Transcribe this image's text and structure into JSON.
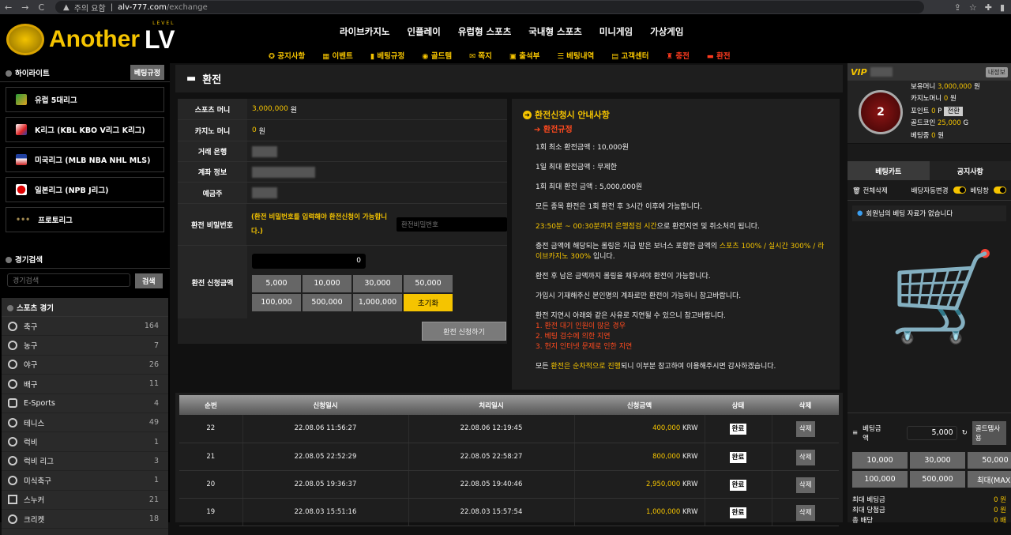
{
  "browser": {
    "warning": "주의 요함",
    "host": "alv-777.com",
    "path": "/exchange"
  },
  "logo": {
    "text": "Another",
    "lv": "LV",
    "level": "LEVEL"
  },
  "mainnav": [
    "라이브카지노",
    "인플레이",
    "유럽형 스포츠",
    "국내형 스포츠",
    "미니게임",
    "가상게임"
  ],
  "subnav": [
    {
      "icon": "gear-icon",
      "label": "공지사항"
    },
    {
      "icon": "gift-icon",
      "label": "이벤트"
    },
    {
      "icon": "book-icon",
      "label": "베팅규정"
    },
    {
      "icon": "coin-icon",
      "label": "골드템"
    },
    {
      "icon": "mail-icon",
      "label": "쪽지"
    },
    {
      "icon": "calendar-icon",
      "label": "출석부"
    },
    {
      "icon": "list-icon",
      "label": "베팅내역"
    },
    {
      "icon": "headset-icon",
      "label": "고객센터"
    },
    {
      "icon": "bank-icon",
      "label": "충전"
    },
    {
      "icon": "card-icon",
      "label": "환전"
    }
  ],
  "sidebar": {
    "highlight_title": "하이라이트",
    "rules_btn": "베팅규정",
    "leagues": [
      "유럽 5대리그",
      "K리그 (KBL KBO V리그 K리그)",
      "미국리그 (MLB NBA NHL MLS)",
      "일본리그 (NPB J리그)",
      "프로토리그"
    ],
    "search_title": "경기검색",
    "search_placeholder": "경기검색",
    "search_btn": "검색",
    "sports_title": "스포츠 경기",
    "sports": [
      {
        "name": "축구",
        "count": "164"
      },
      {
        "name": "농구",
        "count": "7"
      },
      {
        "name": "야구",
        "count": "26"
      },
      {
        "name": "배구",
        "count": "11"
      },
      {
        "name": "E-Sports",
        "count": "4"
      },
      {
        "name": "테니스",
        "count": "49"
      },
      {
        "name": "럭비",
        "count": "1"
      },
      {
        "name": "럭비 리그",
        "count": "3"
      },
      {
        "name": "미식축구",
        "count": "1"
      },
      {
        "name": "스누커",
        "count": "21"
      },
      {
        "name": "크리켓",
        "count": "18"
      }
    ]
  },
  "page": {
    "title": "환전"
  },
  "form": {
    "sports_money_label": "스포츠 머니",
    "sports_money": "3,000,000",
    "won": "원",
    "casino_money_label": "카지노 머니",
    "casino_money": "0",
    "bank_label": "거래 은행",
    "account_label": "계좌 정보",
    "holder_label": "예금주",
    "pw_label": "환전 비밀번호",
    "pw_notice": "(환전 비밀번호를 입력해야 환전신청이 가능합니다.)",
    "pw_placeholder": "환전비밀번호",
    "amount_label": "환전 신청금액",
    "amount_value": "0",
    "quick": [
      "5,000",
      "10,000",
      "30,000",
      "50,000",
      "100,000",
      "500,000",
      "1,000,000"
    ],
    "reset": "초기화",
    "apply": "환전 신청하기"
  },
  "notice": {
    "title": "환전신청시 안내사항",
    "rule_title": "환전규정",
    "min": "1회 최소 환전금액 : 10,000원",
    "daily": "1일 최대 환전금액 : 무제한",
    "max": "1회 최대 환전 금액 : 5,000,000원",
    "p1": "모든 종목 환전은 1회 환전 후 3시간 이후에 가능합니다.",
    "p2a": "23:50분 ~ 00:30분까지 은행점검 시간",
    "p2b": "으로 환전지연 및 취소처리 됩니다.",
    "p3a": "충전 금액에 해당되는 롤링은 지급 받은 보너스 포함한 금액의 ",
    "p3b": "스포츠 100% / 실시간 300% / 라이브카지노 300%",
    "p3c": " 입니다.",
    "p4": "환전 후 남은 금액까지 롤링을 채우셔야 환전이 가능합니다.",
    "p5": "가입시 기재해주신 본인명의 계좌로만 환전이 가능하니 참고바랍니다.",
    "p6": "환전 지연시 아래와 같은 사유로 지연될 수 있으니 참고바랍니다.",
    "r1": "1. 환전 대기 인원이 많은 경우",
    "r2": "2. 베팅 검수에 의한 지연",
    "r3": "3. 현지 인터넷 문제로 인한 지연",
    "p7a": "모든 ",
    "p7b": "환전은 순차적으로 진행",
    "p7c": "되니 이부분 참고하여 이용해주시면 감사하겠습니다."
  },
  "history": {
    "headers": [
      "순번",
      "신청일시",
      "처리일시",
      "신청금액",
      "상태",
      "삭제"
    ],
    "currency": "KRW",
    "rows": [
      {
        "no": "22",
        "req": "22.08.06 11:56:27",
        "done": "22.08.06 12:19:45",
        "amount": "400,000",
        "status": "완료",
        "del": "삭제"
      },
      {
        "no": "21",
        "req": "22.08.05 22:52:29",
        "done": "22.08.05 22:58:27",
        "amount": "800,000",
        "status": "완료",
        "del": "삭제"
      },
      {
        "no": "20",
        "req": "22.08.05 19:36:37",
        "done": "22.08.05 19:40:46",
        "amount": "2,950,000",
        "status": "완료",
        "del": "삭제"
      },
      {
        "no": "19",
        "req": "22.08.03 15:51:16",
        "done": "22.08.03 15:57:54",
        "amount": "1,000,000",
        "status": "완료",
        "del": "삭제"
      }
    ]
  },
  "user": {
    "vip": "VIP",
    "myinfo": "내정보",
    "level": "2",
    "money_label": "보유머니",
    "money": "3,000,000",
    "won": "원",
    "casino_label": "카지노머니",
    "casino": "0",
    "point_label": "포인트",
    "point": "0",
    "point_unit": "P",
    "convert": "전환",
    "gold_label": "골드코인",
    "gold": "25,000",
    "gold_unit": "G",
    "betting_label": "베팅중",
    "betting": "0"
  },
  "betslip": {
    "tabs": [
      "베팅카트",
      "공지사항"
    ],
    "clear": "전체삭제",
    "auto_odds": "배당자동변경",
    "bet_toggle": "베팅창",
    "empty": "회원님의 베팅 자료가 없습니다",
    "amount_label": "베팅금액",
    "amount": "5,000",
    "gold_use": "골드템사용",
    "quick": [
      "10,000",
      "30,000",
      "50,000",
      "100,000",
      "500,000",
      "최대(MAX)"
    ],
    "max_bet_label": "최대 베팅금",
    "max_bet": "0 원",
    "max_win_label": "최대 당첨금",
    "max_win": "0 원",
    "total_odds_label": "총 배당",
    "total_odds": "0 배"
  },
  "colors": {
    "accent": "#f5c400",
    "alert": "#ff4a1f"
  }
}
